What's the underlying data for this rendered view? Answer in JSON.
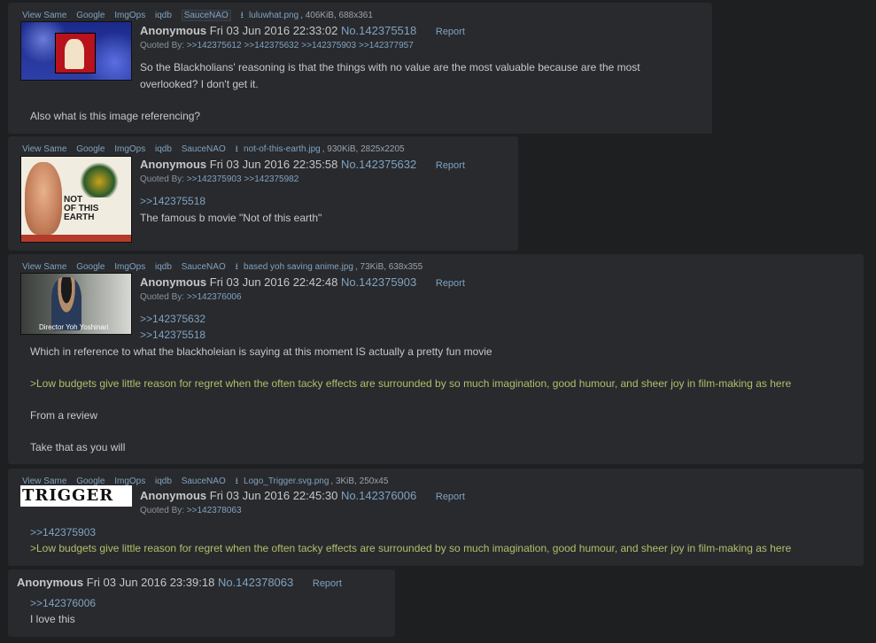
{
  "posts": [
    {
      "file_links": [
        "View Same",
        "Google",
        "ImgOps",
        "iqdb",
        "SauceNAO"
      ],
      "file_name": "luluwhat.png",
      "file_meta": ", 406KiB, 688x361",
      "name": "Anonymous",
      "date": "Fri 03 Jun 2016 22:33:02",
      "no": "No.142375518",
      "report": "Report",
      "quoted_by_label": "Quoted By:",
      "quoted_by": [
        ">>142375612",
        ">>142375632",
        ">>142375903",
        ">>142377957"
      ],
      "lines": [
        "So the Blackholians' reasoning is that the things with no value are the most valuable because are the most",
        "overlooked? I don't get it.",
        "Also what is this image referencing?"
      ]
    },
    {
      "file_links": [
        "View Same",
        "Google",
        "ImgOps",
        "iqdb",
        "SauceNAO"
      ],
      "file_name": "not-of-this-earth.jpg",
      "file_meta": ", 930KiB, 2825x2205",
      "name": "Anonymous",
      "date": "Fri 03 Jun 2016 22:35:58",
      "no": "No.142375632",
      "report": "Report",
      "quoted_by_label": "Quoted By:",
      "quoted_by": [
        ">>142375903",
        ">>142375982"
      ],
      "quote_link": ">>142375518",
      "lines": [
        "The famous b movie \"Not of this earth\""
      ]
    },
    {
      "file_links": [
        "View Same",
        "Google",
        "ImgOps",
        "iqdb",
        "SauceNAO"
      ],
      "file_name": "based yoh saving anime.jpg",
      "file_meta": ", 73KiB, 638x355",
      "name": "Anonymous",
      "date": "Fri 03 Jun 2016 22:42:48",
      "no": "No.142375903",
      "report": "Report",
      "quoted_by_label": "Quoted By:",
      "quoted_by": [
        ">>142376006"
      ],
      "quote_links": [
        ">>142375632",
        ">>142375518"
      ],
      "lines": [
        "Which in reference to what the blackholeian is saying at this moment IS actually a pretty fun movie",
        ">Low budgets give little reason for regret when the often tacky effects are surrounded by so much imagination, good humour, and sheer joy in film-making as here",
        "From a review",
        "Take that as you will"
      ]
    },
    {
      "file_links": [
        "View Same",
        "Google",
        "ImgOps",
        "iqdb",
        "SauceNAO"
      ],
      "file_name": "Logo_Trigger.svg.png",
      "file_meta": ", 3KiB, 250x45",
      "name": "Anonymous",
      "date": "Fri 03 Jun 2016 22:45:30",
      "no": "No.142376006",
      "report": "Report",
      "quoted_by_label": "Quoted By:",
      "quoted_by": [
        ">>142378063"
      ],
      "quote_link": ">>142375903",
      "lines": [
        ">Low budgets give little reason for regret when the often tacky effects are surrounded by so much imagination, good humour, and sheer joy in film-making as here"
      ]
    },
    {
      "name": "Anonymous",
      "date": "Fri 03 Jun 2016 23:39:18",
      "no": "No.142378063",
      "report": "Report",
      "quote_link": ">>142376006",
      "lines": [
        "I love this"
      ]
    }
  ],
  "images": {
    "poster_title_1": "NOT",
    "poster_title_2": "OF THIS",
    "poster_title_3": "EARTH",
    "caption": "Director Yoh Yoshinari",
    "logo_text": "TRIGGER"
  },
  "colors": {
    "background": "#1d1f21",
    "post": "#282a2e",
    "link": "#81a2be",
    "greentext": "#b5bd68",
    "text": "#c5c8c6"
  }
}
